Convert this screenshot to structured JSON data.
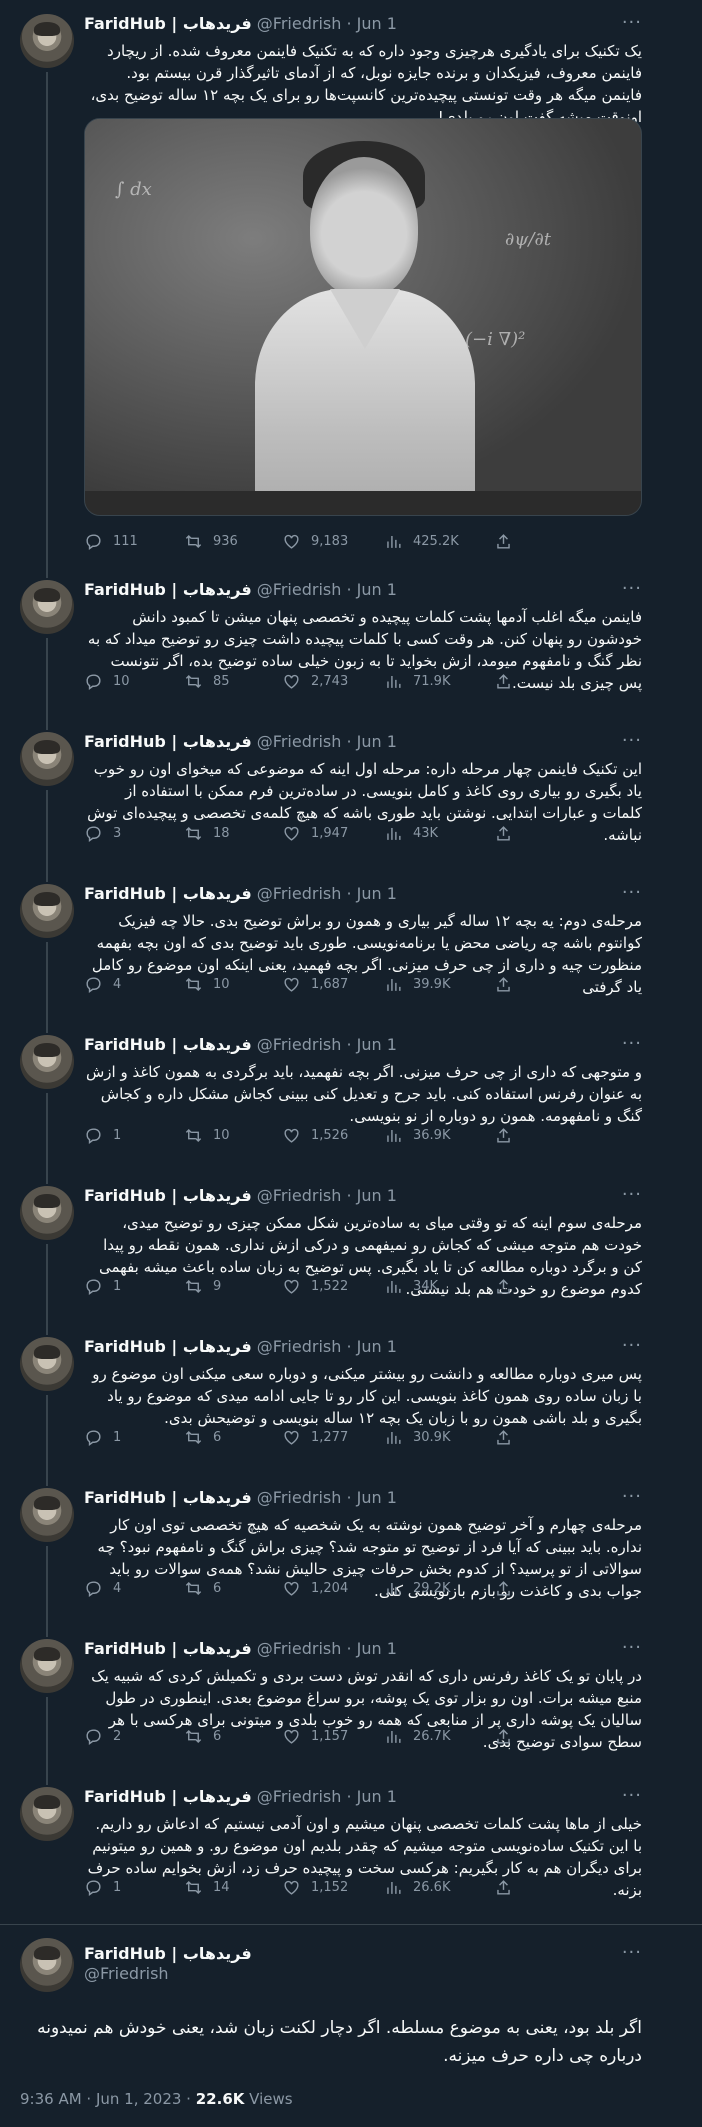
{
  "user": {
    "name": "FaridHub | فریدهاب",
    "handle": "@Friedrish",
    "date": "Jun 1"
  },
  "tweets": [
    {
      "text": "یک تکنیک برای یادگیری هرچیزی وجود داره که به تکنیک فاینمن معروف شده. از ریچارد فاینمن معروف، فیزیکدان و برنده جایزه نوبل، که از آدمای تاثیرگذار قرن بیستم بود. فاینمن میگه هر وقت تونستی پیچیده‌ترین کانسپت‌ها رو برای یک بچه ۱۲ ساله توضیح بدی، اونوقت میشه گفت اون رو بلدی!",
      "replies": "111",
      "retweets": "936",
      "likes": "9,183",
      "views": "425.2K"
    },
    {
      "text": "فاینمن میگه اغلب آدمها پشت کلمات پیچیده و تخصصی پنهان میشن تا کمبود دانش خودشون رو پنهان کنن. هر وقت کسی با کلمات پیچیده داشت چیزی رو توضیح میداد که به نظر گنگ و نامفهوم میومد، ازش بخواید تا به زبون خیلی ساده توضیح بده، اگر نتونست پس چیزی بلد نیست.",
      "replies": "10",
      "retweets": "85",
      "likes": "2,743",
      "views": "71.9K"
    },
    {
      "text": "این تکنیک فاینمن چهار مرحله داره: مرحله اول اینه که موضوعی که میخوای اون رو خوب یاد بگیری رو بیاری روی کاغذ و کامل بنویسی. در ساده‌ترین فرم ممکن با استفاده از کلمات و عبارات ابتدایی. نوشتن باید طوری باشه که هیچ کلمه‌ی تخصصی و پیچیده‌ای توش نباشه.",
      "replies": "3",
      "retweets": "18",
      "likes": "1,947",
      "views": "43K"
    },
    {
      "text": "مرحله‌ی دوم: یه بچه ۱۲ ساله گیر بیاری و همون رو براش توضیح بدی. حالا چه فیزیک کوانتوم باشه چه ریاضی محض یا برنامه‌نویسی. طوری باید توضیح بدی که اون بچه بفهمه منظورت چیه و داری از چی حرف میزنی. اگر بچه فهمید، یعنی اینکه اون موضوع رو کامل یاد گرفتی",
      "replies": "4",
      "retweets": "10",
      "likes": "1,687",
      "views": "39.9K"
    },
    {
      "text": "و متوجهی که داری از چی حرف میزنی. اگر بچه نفهمید، باید برگردی به همون کاغذ و ازش به عنوان رفرنس استفاده کنی. باید جرح و تعدیل کنی ببینی کجاش مشکل داره و کجاش گنگ و نامفهومه. همون رو دوباره از نو بنویسی.",
      "replies": "1",
      "retweets": "10",
      "likes": "1,526",
      "views": "36.9K"
    },
    {
      "text": "مرحله‌ی سوم اینه که تو وقتی میای به ساده‌ترین شکل ممکن چیزی رو توضیح میدی، خودت هم متوجه میشی که کجاش رو نمیفهمی و درکی ازش نداری. همون نقطه رو پیدا کن و برگرد دوباره مطالعه کن تا یاد بگیری. پس توضیح به زبان ساده باعث میشه بفهمی کدوم موضوع رو خودت هم بلد نیستی.",
      "replies": "1",
      "retweets": "9",
      "likes": "1,522",
      "views": "34K"
    },
    {
      "text": "پس میری دوباره مطالعه و دانشت رو بیشتر میکنی، و دوباره سعی میکنی اون موضوع رو با زبان ساده روی همون کاغذ بنویسی. این کار رو تا جایی ادامه میدی که موضوع رو یاد بگیری و بلد باشی همون رو با زبان یک بچه ۱۲ ساله بنویسی و توضیحش بدی.",
      "replies": "1",
      "retweets": "6",
      "likes": "1,277",
      "views": "30.9K"
    },
    {
      "text": "مرحله‌ی چهارم و آخر توضیح همون نوشته به یک شخصیه که هیچ تخصصی توی اون کار نداره. باید ببینی که آیا فرد از توضیح تو متوجه شد؟ چیزی براش گنگ و نامفهوم نبود؟ چه سوالاتی از تو پرسید؟ از کدوم بخش حرفات چیزی حالیش نشد؟ همه‌ی سوالات رو باید جواب بدی و کاغذت رو بازم بازنویسی کنی.",
      "replies": "4",
      "retweets": "6",
      "likes": "1,204",
      "views": "29.2K"
    },
    {
      "text": "در پایان تو یک کاغذ رفرنس داری که انقدر توش دست بردی و تکمیلش کردی که شبیه یک منبع میشه برات. اون رو بزار توی یک پوشه، برو سراغ موضوع بعدی. اینطوری در طول سالیان یک پوشه داری پر از منابعی که همه رو خوب بلدی و میتونی برای هرکسی با هر سطح سوادی توضیح بدی.",
      "replies": "2",
      "retweets": "6",
      "likes": "1,157",
      "views": "26.7K"
    },
    {
      "text": "خیلی از ماها پشت کلمات تخصصی پنهان میشیم و اون آدمی نیستیم که ادعاش رو داریم. با این تکنیک ساده‌نویسی متوجه میشیم که چقدر بلدیم اون موضوع رو. و همین رو میتونیم برای دیگران هم به کار بگیریم: هرکسی سخت و پیچیده حرف زد، ازش بخوایم ساده حرف بزنه.",
      "replies": "1",
      "retweets": "14",
      "likes": "1,152",
      "views": "26.6K"
    }
  ],
  "final": {
    "text": "اگر بلد بود، یعنی به موضوع مسلطه. اگر دچار لکنت زبان شد، یعنی خودش هم نمیدونه درباره چی داره حرف میزنه.",
    "time": "9:36 AM · Jun 1, 2023 ·",
    "views_count": "22.6K",
    "views_label": "Views"
  },
  "icons": {
    "more": "more-icon",
    "reply": "reply-icon",
    "retweet": "retweet-icon",
    "like": "heart-icon",
    "views": "views-icon",
    "share": "share-icon"
  },
  "colors": {
    "background": "#15202b",
    "text": "#f7f9f9",
    "muted": "#8b98a5",
    "border": "#38444d"
  }
}
